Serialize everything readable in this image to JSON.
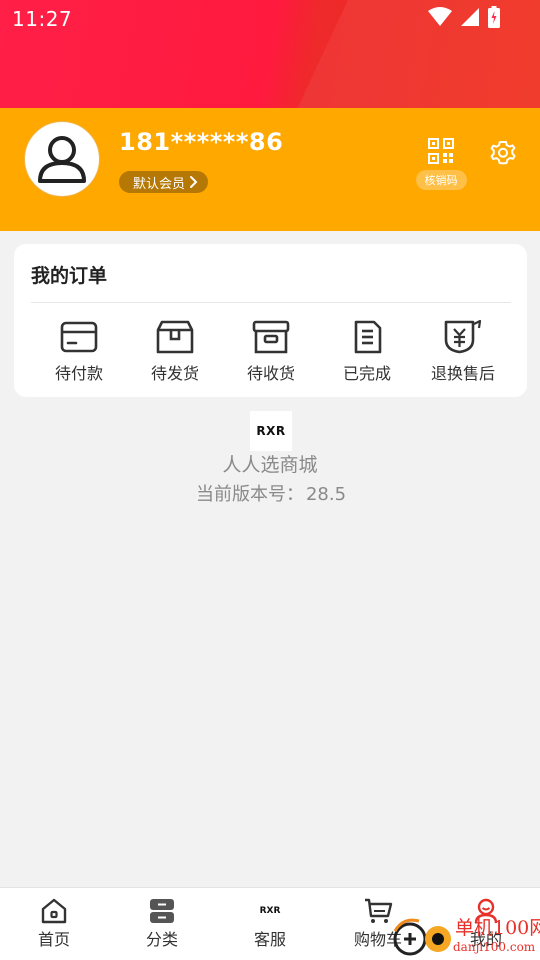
{
  "status_bar": {
    "time": "11:27"
  },
  "profile": {
    "phone": "181******86",
    "member_level": "默认会员",
    "qr_label": "核销码"
  },
  "orders": {
    "title": "我的订单",
    "items": [
      {
        "label": "待付款",
        "icon": "wallet-card-icon"
      },
      {
        "label": "待发货",
        "icon": "box-icon"
      },
      {
        "label": "待收货",
        "icon": "archive-box-icon"
      },
      {
        "label": "已完成",
        "icon": "document-icon"
      },
      {
        "label": "退换售后",
        "icon": "refund-yen-icon"
      }
    ]
  },
  "about": {
    "logo_text": "RXR",
    "app_name": "人人选商城",
    "version_label": "当前版本号：",
    "version": "28.5"
  },
  "bottom_nav": {
    "items": [
      {
        "label": "首页",
        "icon": "home-icon"
      },
      {
        "label": "分类",
        "icon": "category-icon"
      },
      {
        "label": "客服",
        "icon": "rxr-logo-icon"
      },
      {
        "label": "购物车",
        "icon": "cart-icon"
      },
      {
        "label": "我的",
        "icon": "profile-icon"
      }
    ],
    "active_index": 4
  },
  "watermark": {
    "text": "单机100网",
    "url": "danji100.com"
  },
  "colors": {
    "header_red": "#ff1f47",
    "profile_orange": "#ffa800",
    "accent": "#e8302a"
  }
}
